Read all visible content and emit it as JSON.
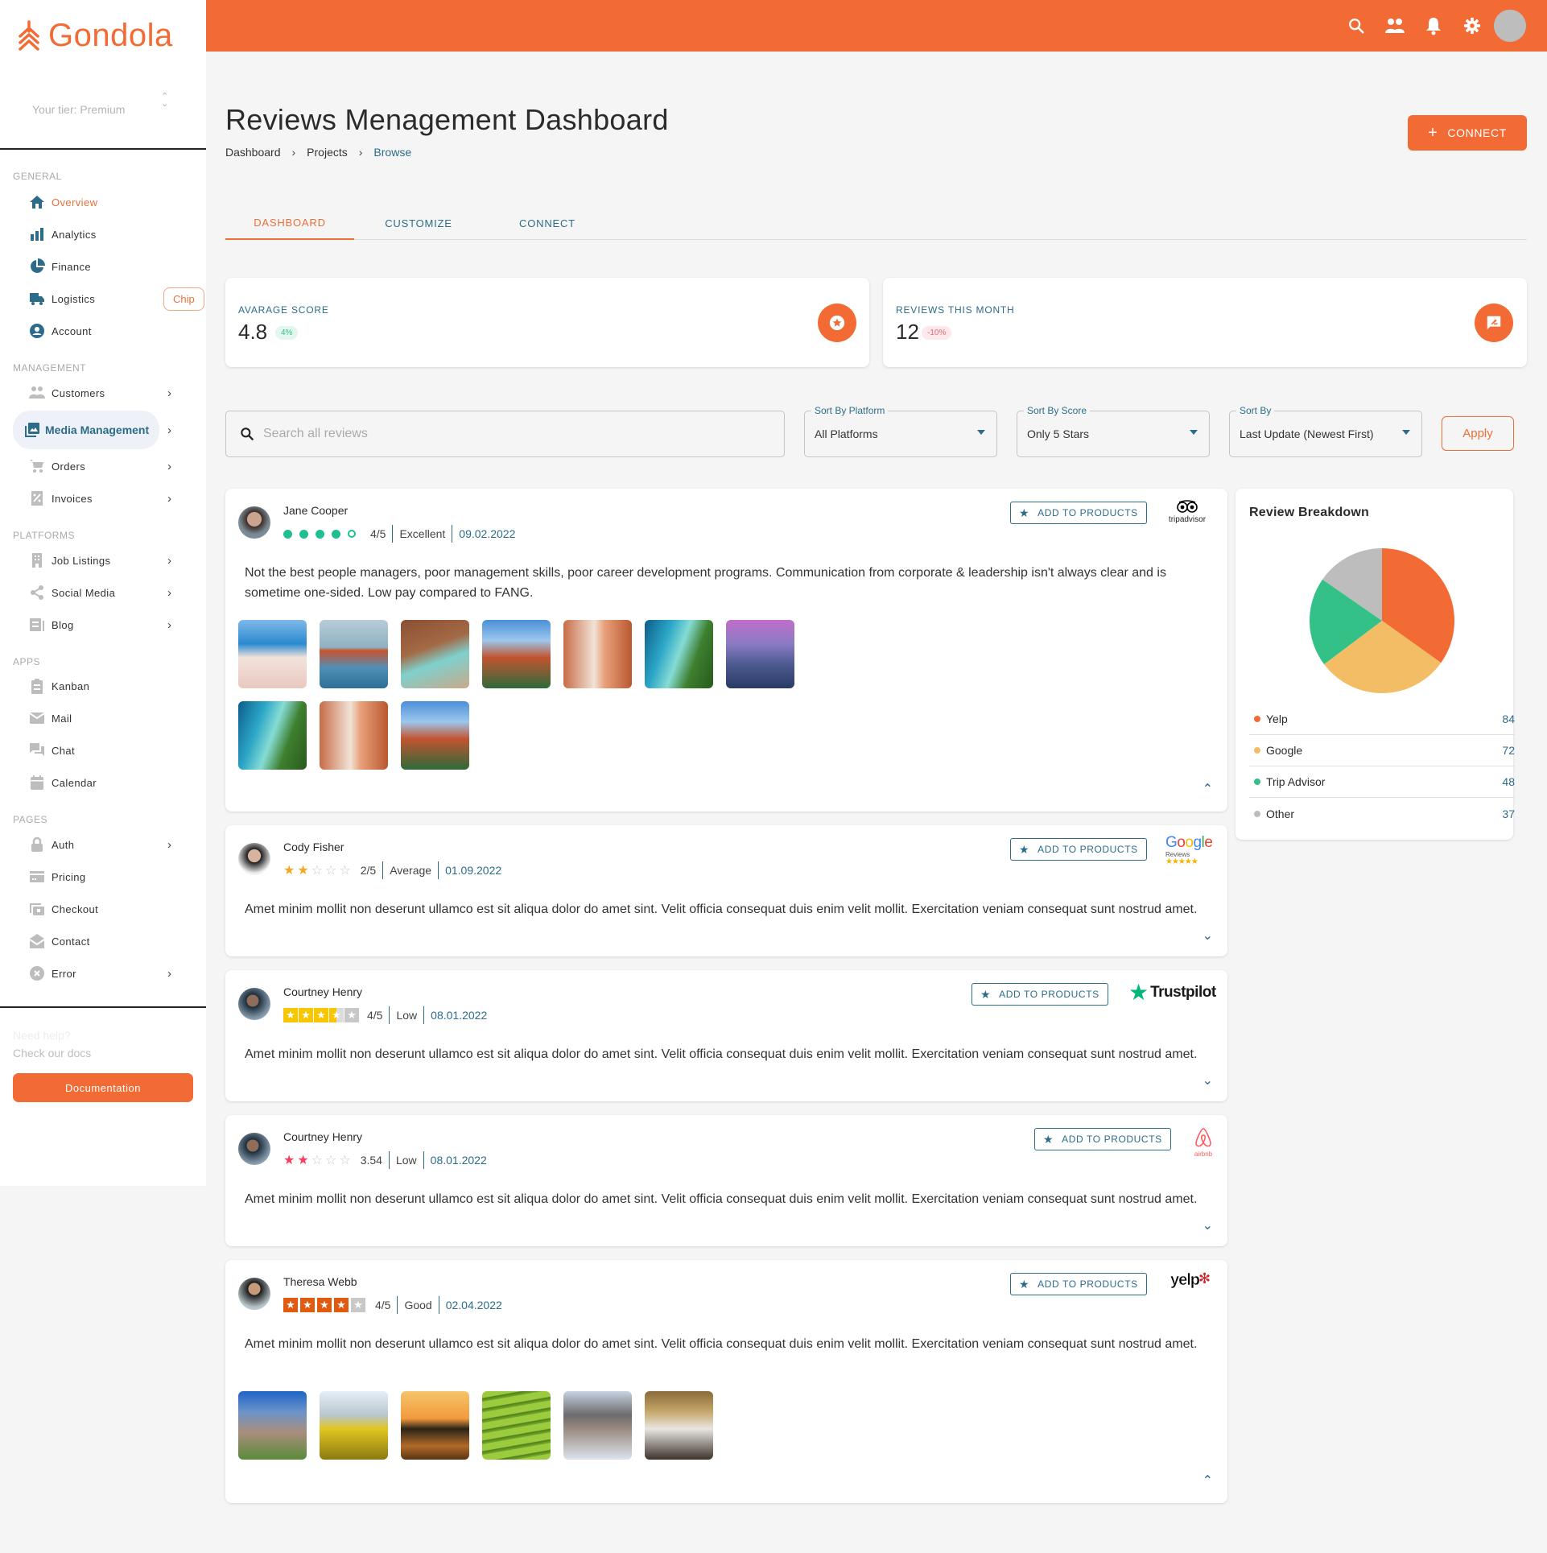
{
  "brand": {
    "name": "Gondola",
    "tier": "Your tier: Premium",
    "accent": "#f26b35",
    "secondary": "#2c6c8a"
  },
  "sidebar": {
    "sections": [
      {
        "label": "GENERAL",
        "items": [
          {
            "label": "Overview",
            "icon": "home-icon",
            "active": true
          },
          {
            "label": "Analytics",
            "icon": "bar-chart-icon"
          },
          {
            "label": "Finance",
            "icon": "pie-chart-icon"
          },
          {
            "label": "Logistics",
            "icon": "truck-icon",
            "chip": "Chip"
          },
          {
            "label": "Account",
            "icon": "account-circle-icon"
          }
        ]
      },
      {
        "label": "MANAGEMENT",
        "items": [
          {
            "label": "Customers",
            "icon": "people-icon",
            "chevron": true
          },
          {
            "label": "Media Management",
            "icon": "photo-library-icon",
            "chevron": true,
            "selected": true
          },
          {
            "label": "Orders",
            "icon": "cart-icon",
            "chevron": true
          },
          {
            "label": "Invoices",
            "icon": "receipt-icon",
            "chevron": true
          }
        ]
      },
      {
        "label": "PLATFORMS",
        "items": [
          {
            "label": "Job  Listings",
            "icon": "building-icon",
            "chevron": true
          },
          {
            "label": "Social  Media",
            "icon": "share-icon",
            "chevron": true
          },
          {
            "label": "Blog",
            "icon": "article-icon",
            "chevron": true
          }
        ]
      },
      {
        "label": "APPS",
        "items": [
          {
            "label": "Kanban",
            "icon": "clipboard-icon"
          },
          {
            "label": "Mail",
            "icon": "mail-icon"
          },
          {
            "label": "Chat",
            "icon": "chat-icon"
          },
          {
            "label": "Calendar",
            "icon": "calendar-icon"
          }
        ]
      },
      {
        "label": "PAGES",
        "items": [
          {
            "label": "Auth",
            "icon": "lock-icon",
            "chevron": true
          },
          {
            "label": "Pricing",
            "icon": "credit-card-icon"
          },
          {
            "label": "Checkout",
            "icon": "checkout-icon"
          },
          {
            "label": "Contact",
            "icon": "contact-mail-icon"
          },
          {
            "label": "Error",
            "icon": "error-icon",
            "chevron": true
          }
        ]
      }
    ],
    "help_title": "Need help?",
    "help_subtitle": "Check our docs",
    "documentation_label": "Documentation"
  },
  "topbar": {
    "icons": [
      "search-icon",
      "people-icon",
      "bell-icon",
      "gear-icon",
      "avatar"
    ]
  },
  "header": {
    "title": "Reviews Menagement Dashboard",
    "breadcrumb": [
      "Dashboard",
      "Projects",
      "Browse"
    ],
    "connect_label": "CONNECT"
  },
  "tabs": [
    {
      "label": "DASHBOARD",
      "active": true
    },
    {
      "label": "CUSTOMIZE"
    },
    {
      "label": "CONNECT"
    }
  ],
  "stats": [
    {
      "label": "AVARAGE SCORE",
      "value": "4.8",
      "badge": "4%",
      "trend": "up",
      "icon": "star-circle-icon"
    },
    {
      "label": "REVIEWS THIS MONTH",
      "value": "12",
      "badge": "-10%",
      "trend": "down",
      "icon": "rate-review-icon"
    }
  ],
  "filters": {
    "search_placeholder": "Search all reviews",
    "platform": {
      "label": "Sort By Platform",
      "value": "All Platforms"
    },
    "score": {
      "label": "Sort By Score",
      "value": "Only 5 Stars"
    },
    "sort": {
      "label": "Sort By",
      "value": "Last Update (Newest First)"
    },
    "apply_label": "Apply"
  },
  "add_to_products_label": "ADD TO PRODUCTS",
  "reviews": [
    {
      "name": "Jane Cooper",
      "rating": 4,
      "rating_style": "tripadvisor-dots",
      "score": "4/5",
      "grade": "Excellent",
      "date": "09.02.2022",
      "platform": "tripadvisor",
      "text": "Not the best people managers, poor management skills, poor career development programs. Communication from corporate & leadership isn't always clear and is sometime one-sided. Low pay compared to FANG.",
      "expanded": true,
      "photos": [
        "santorini",
        "torii-gate",
        "resort-pool",
        "st-basils",
        "corridor",
        "beach-aerial",
        "blue-mosque",
        "beach-aerial",
        "corridor",
        "st-basils"
      ]
    },
    {
      "name": "Cody Fisher",
      "rating": 2,
      "rating_style": "google-stars",
      "score": "2/5",
      "grade": "Average",
      "date": "01.09.2022",
      "platform": "google",
      "text": "Amet minim mollit non deserunt ullamco est sit aliqua dolor do amet sint. Velit officia consequat duis enim velit mollit. Exercitation veniam consequat sunt nostrud amet.",
      "expanded": false,
      "photos": []
    },
    {
      "name": "Courtney Henry",
      "rating": 3.5,
      "rating_style": "trustpilot-squares",
      "score": "4/5",
      "grade": "Low",
      "date": "08.01.2022",
      "platform": "trustpilot",
      "text": "Amet minim mollit non deserunt ullamco est sit aliqua dolor do amet sint. Velit officia consequat duis enim velit mollit. Exercitation veniam consequat sunt nostrud amet.",
      "expanded": false,
      "photos": []
    },
    {
      "name": "Courtney Henry",
      "rating": 2,
      "rating_style": "airbnb-stars",
      "score": "3.54",
      "grade": "Low",
      "date": "08.01.2022",
      "platform": "airbnb",
      "text": "Amet minim mollit non deserunt ullamco est sit aliqua dolor do amet sint. Velit officia consequat duis enim velit mollit. Exercitation veniam consequat sunt nostrud amet.",
      "expanded": false,
      "photos": []
    },
    {
      "name": "Theresa Webb",
      "rating": 4,
      "rating_style": "yelp-squares",
      "score": "4/5",
      "grade": "Good",
      "date": "02.04.2022",
      "platform": "yelp",
      "text": "Amet minim mollit non deserunt ullamco est sit aliqua dolor do amet sint. Velit officia consequat duis enim velit mollit. Exercitation veniam consequat sunt nostrud amet.",
      "expanded": true,
      "photos": [
        "cathedral",
        "yellow-flowers",
        "sunset-lake",
        "rice-terraces",
        "hippo",
        "palace-interior"
      ]
    }
  ],
  "platform_logos": {
    "tripadvisor": "tripadvisor",
    "google": "Google",
    "google_sub": "Reviews",
    "trustpilot": "Trustpilot",
    "airbnb": "airbnb",
    "yelp": "yelp"
  },
  "breakdown": {
    "title": "Review Breakdown"
  },
  "chart_data": {
    "type": "pie",
    "title": "Review Breakdown",
    "categories": [
      "Yelp",
      "Google",
      "Trip Advisor",
      "Other"
    ],
    "values": [
      84,
      72,
      48,
      37
    ],
    "colors": [
      "#f26b35",
      "#f3bd66",
      "#33c187",
      "#bdbdbd"
    ],
    "legend": "bottom"
  }
}
